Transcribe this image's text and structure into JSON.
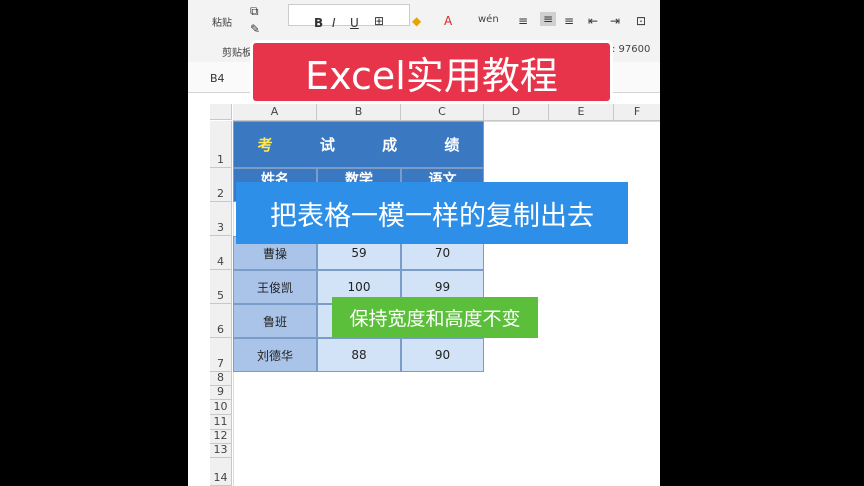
{
  "ribbon": {
    "paste_label": "粘贴",
    "clipboard_label": "剪贴板",
    "bold": "B",
    "italic": "I",
    "underline": "U",
    "wrap_label": "wén",
    "status_fragment": ": 97600"
  },
  "formula_bar": {
    "name_box": "B4"
  },
  "columns": [
    "A",
    "B",
    "C",
    "D",
    "E",
    "F"
  ],
  "rows": [
    "1",
    "2",
    "3",
    "4",
    "5",
    "6",
    "7",
    "8",
    "9",
    "10",
    "11",
    "12",
    "13",
    "14"
  ],
  "table": {
    "title": [
      "考",
      "试",
      "成",
      "绩"
    ],
    "header_partial": [
      "姓名",
      "数学",
      "语文"
    ],
    "data": [
      {
        "name": "曹操",
        "math": "59",
        "chinese": "70"
      },
      {
        "name": "王俊凯",
        "math": "100",
        "chinese": "99"
      },
      {
        "name": "鲁班",
        "math": "",
        "chinese": ""
      },
      {
        "name": "刘德华",
        "math": "88",
        "chinese": "90"
      }
    ]
  },
  "overlays": {
    "title_banner": "Excel实用教程",
    "blue_banner": "把表格一模一样的复制出去",
    "green_banner": "保持宽度和高度不变"
  },
  "colors": {
    "title_fill": "#3a78c2",
    "name_fill": "#a9c4e8",
    "value_fill": "#d3e3f7",
    "red_banner": "#e8344a",
    "blue_banner": "#2d8fe8",
    "green_banner": "#5bbf3c"
  }
}
